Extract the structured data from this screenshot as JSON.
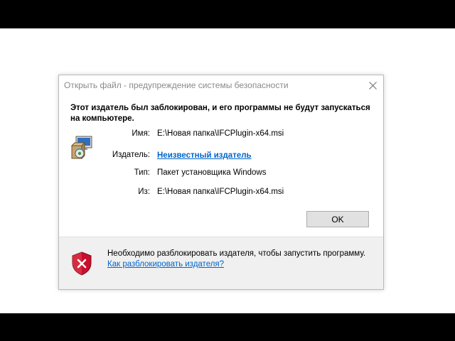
{
  "dialog": {
    "title": "Открыть файл - предупреждение системы безопасности",
    "close_icon": "close-icon",
    "headline": "Этот издатель был заблокирован, и его программы не будут запускаться на компьютере.",
    "package_icon": "installer-package-icon",
    "fields": {
      "name_label": "Имя:",
      "name_value": "E:\\Новая папка\\IFCPlugin-x64.msi",
      "publisher_label": "Издатель:",
      "publisher_value": "Неизвестный издатель",
      "type_label": "Тип:",
      "type_value": "Пакет установщика Windows",
      "from_label": "Из:",
      "from_value": "E:\\Новая папка\\IFCPlugin-x64.msi"
    },
    "ok_label": "OK",
    "footer": {
      "shield_icon": "security-shield-error-icon",
      "text": "Необходимо разблокировать издателя, чтобы запустить программу.",
      "link": "Как разблокировать издателя?"
    }
  },
  "colors": {
    "link": "#0066cc",
    "title_text": "#8a8a8a",
    "footer_bg": "#f0f0f0",
    "shield_red": "#c8102e",
    "button_bg": "#e1e1e1"
  }
}
